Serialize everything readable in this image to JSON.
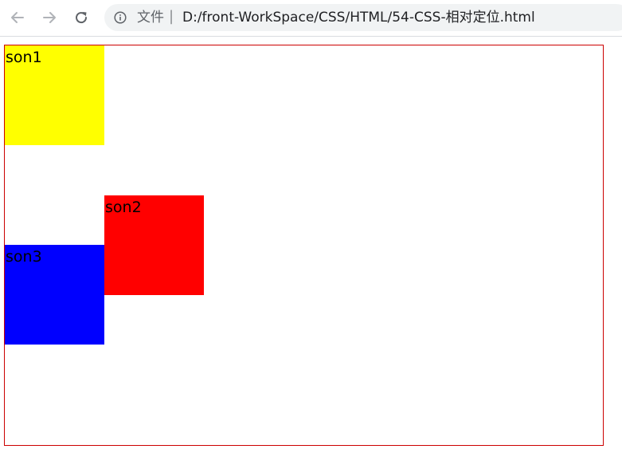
{
  "browser": {
    "back_icon": "arrow-left-icon",
    "forward_icon": "arrow-right-icon",
    "reload_icon": "reload-icon",
    "info_icon": "info-icon",
    "address_prefix": "文件",
    "address_separator": "|",
    "address_url": "D:/front-WorkSpace/CSS/HTML/54-CSS-相对定位.html"
  },
  "page": {
    "container_border_color": "#cc0000",
    "boxes": [
      {
        "label": "son1",
        "color": "#ffff00"
      },
      {
        "label": "son2",
        "color": "#ff0000"
      },
      {
        "label": "son3",
        "color": "#0000ff"
      }
    ]
  }
}
